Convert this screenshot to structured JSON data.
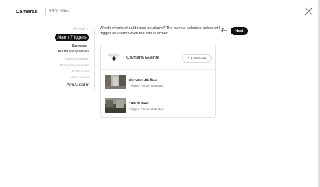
{
  "header": {
    "title": "Cameras",
    "subtitle": "3500 19th"
  },
  "steps": {
    "general": "General",
    "alarm_triggers": "Alarm Triggers",
    "cameras": "Cameras",
    "alarm_responses": "Alarm Responses",
    "video_verification": "Video Verification",
    "emergency_dispatch": "Emergency Dispatch",
    "notifications": "Notifications",
    "alarm_actions": "Alarm Actions",
    "arm_disarm": "Arm/Disarm"
  },
  "main": {
    "question": "Which events should raise an alarm? The events selected below will trigger an alarm when the site is armed.",
    "next_label": "Next"
  },
  "card": {
    "title": "Camera Events",
    "cameras_button": "2 Cameras",
    "events": [
      {
        "title": "Elevator: 4th floor",
        "subtitle": "Trigger: Person Detected"
      },
      {
        "title": "19th St West",
        "subtitle": "Trigger: Person Detected"
      }
    ]
  },
  "icons": {
    "close": "close-icon",
    "back": "arrow-left-icon",
    "camera": "dome-camera-icon",
    "plus": "plus-icon",
    "check": "check-icon"
  },
  "colors": {
    "primary_dark": "#111111",
    "accent_blue": "#3a7bd5",
    "muted_text": "#b0b0b0"
  }
}
